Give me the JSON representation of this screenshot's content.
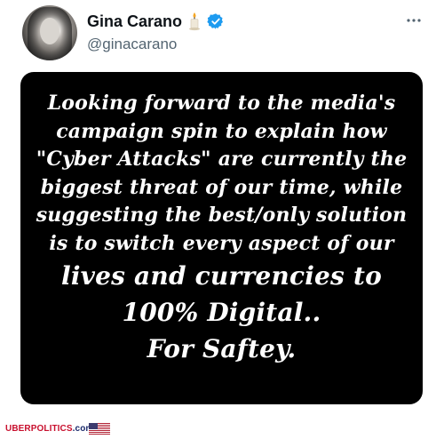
{
  "tweet": {
    "author_name": "Gina Carano",
    "author_handle": "@ginacarano",
    "name_emoji_icon": "candle-icon",
    "verified_icon": "verified-badge-icon",
    "more_icon": "more-options-icon",
    "image_text": {
      "line1": "Looking forward to the media's",
      "line2": "campaign spin to explain how",
      "line3": "\"Cyber Attacks\" are currently the",
      "line4": "biggest threat of our time, while",
      "line5": "suggesting the best/only solution",
      "line6": "is to switch every aspect of our",
      "line7": "lives and currencies to",
      "line8": "100% Digital..",
      "line9": "For Saftey."
    }
  },
  "watermark": {
    "part1": "UBERPOLITICS",
    "part2": ".com",
    "flag_icon": "us-flag-icon"
  },
  "colors": {
    "verified_blue": "#1d9bf0",
    "name": "#0f1419",
    "handle": "#536471",
    "watermark_red": "#c8102e",
    "watermark_blue": "#1a2a6c"
  }
}
